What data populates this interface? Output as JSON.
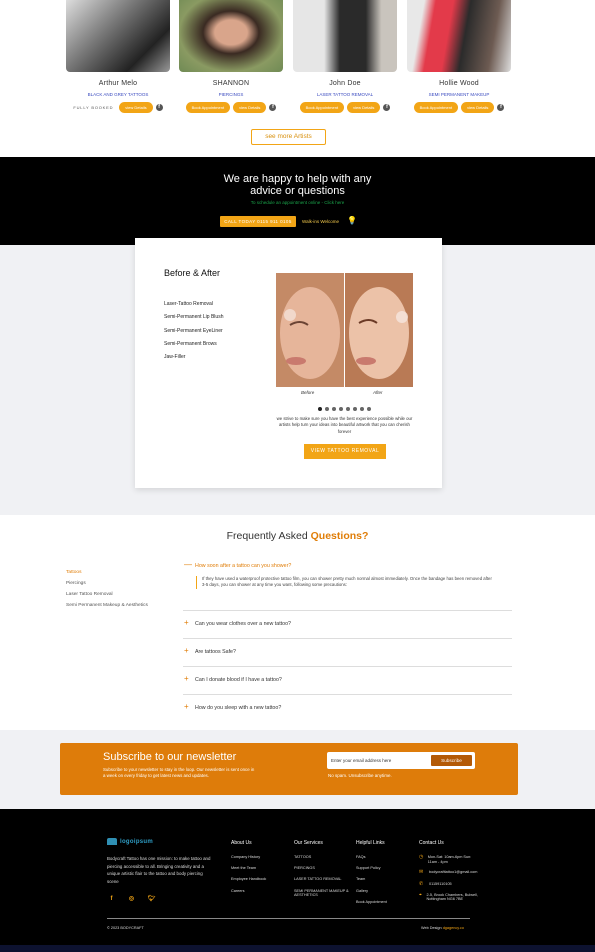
{
  "artists": [
    {
      "name": "Arthur Melo",
      "style": "Black and Grey Tattoos",
      "status": "FULLY BOOKED",
      "primary_btn": "",
      "secondary_btn": "view Details"
    },
    {
      "name": "SHANNON",
      "style": "PIERCINGS",
      "status": "",
      "primary_btn": "Book Appointment",
      "secondary_btn": "view Details"
    },
    {
      "name": "John Doe",
      "style": "LASER TATTOO REMOVAL",
      "status": "",
      "primary_btn": "Book Appointment",
      "secondary_btn": "view Details"
    },
    {
      "name": "Hollie Wood",
      "style": "SEMI PERMANENT MAKEUP",
      "status": "",
      "primary_btn": "Book Appointment",
      "secondary_btn": "view Details"
    }
  ],
  "see_more_label": "see more Artists",
  "help": {
    "title_line1": "We are happy to help with any",
    "title_line2": "advice or questions",
    "subtitle": "To schedule an appointment online - Click here",
    "call_label": "CALL TODAY 0115 911 0105",
    "walkins_label": "Walk-ins Welcome"
  },
  "before_after": {
    "title": "Before & After",
    "services": [
      "Laser-Tattoo Removal",
      "Semi-Permanent Lip Blush",
      "Semi-Permanent EyeLiner",
      "Semi-Permanent Brows",
      "Jaw-Filler"
    ],
    "before_label": "Before",
    "after_label": "After",
    "slide_count": 8,
    "active_slide": 1,
    "description": "we strive to make sure you have the best experience possible while our artists help turn your ideas into beautiful artwork that you can cherish forever",
    "button_label": "VIEW TATTOO REMOVAL"
  },
  "faq": {
    "title_prefix": "Frequently Asked",
    "title_highlight": "Questions?",
    "categories": [
      "Tattoos",
      "Piercings",
      "Laser Tattoo Removal",
      "Semi Permanent Makeup & Aesthetics"
    ],
    "active_category": 0,
    "items": [
      {
        "question": "How soon after a tattoo can you shower?",
        "answer": "If they have used a waterproof protective tattoo film, you can shower pretty much normal almost immediately. Once the bandage has been removed after 3-5 days, you can shower at any time you want, following some precautions:",
        "open": true
      },
      {
        "question": "Can you wear clothes over a new tattoo?",
        "answer": "",
        "open": false
      },
      {
        "question": "Are tattoos Safe?",
        "answer": "",
        "open": false
      },
      {
        "question": "Can I donate blood if I have a tattoo?",
        "answer": "",
        "open": false
      },
      {
        "question": "How do you sleep with a new tattoo?",
        "answer": "",
        "open": false
      }
    ]
  },
  "newsletter": {
    "title": "Subscribe to our newsletter",
    "subtitle": "Subscribe to your newsletter to stay in the loop. Our newsletter is sent once in a week on every friday to get latest news and updates.",
    "placeholder": "Enter your email address here",
    "button_label": "Subscribe",
    "note": "No spam. Unsubscribe anytime."
  },
  "footer": {
    "logo_text": "logoipsum",
    "about": "Bodycraft Tattoo has one mission: to make tattoo and piercing accessible to all. Bringing creativity and a unique artistic flair to the tattoo and body piercing scene",
    "columns": [
      {
        "title": "About Us",
        "links": [
          "Company History",
          "Meet the Team",
          "Employee Handbook",
          "Careers"
        ]
      },
      {
        "title": "Our Services",
        "links": [
          "TATTOOS",
          "PIERCINGS",
          "LASER TATTOO REMOVAL",
          "SEMI PERMANENT MAKEUP & AESTHETICS"
        ]
      },
      {
        "title": "Helpful Links",
        "links": [
          "FAQs",
          "Support Policy",
          "Team",
          "Gallery",
          "Book Appointment"
        ]
      }
    ],
    "contact_title": "Contact Us",
    "contacts": [
      {
        "icon": "clock-icon",
        "text": "Mon-Sat: 10am-6pm Sun: 11am - 4pm"
      },
      {
        "icon": "mail-icon",
        "text": "bodycrafttattoo1@gmail.com"
      },
      {
        "icon": "phone-icon",
        "text": "01159110105"
      },
      {
        "icon": "pin-icon",
        "text": "2-5, Brook Chambers, Bulwell, Nottingham NG6 7BE"
      }
    ],
    "copyright": "© 2023 BODYCRAFT",
    "design_prefix": "Web Design",
    "design_link": "dgagency.co"
  },
  "colors": {
    "accent": "#f2a516",
    "orange": "#de7c0a",
    "black": "#000000",
    "panel": "#f0f1f4"
  }
}
